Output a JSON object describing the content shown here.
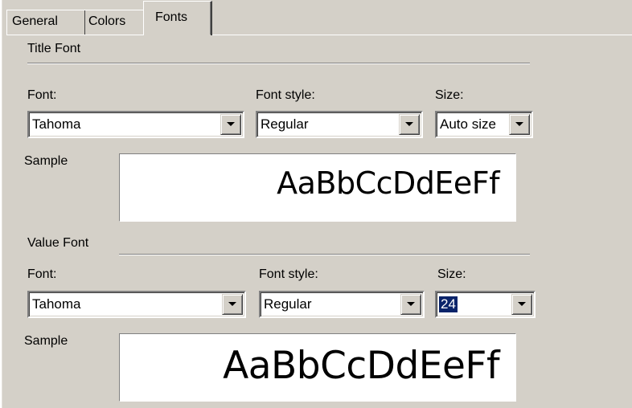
{
  "tabs": [
    {
      "label": "General",
      "active": false
    },
    {
      "label": "Colors",
      "active": false
    },
    {
      "label": "Fonts",
      "active": true
    }
  ],
  "title_font": {
    "heading": "Title Font",
    "font_label": "Font:",
    "font_value": "Tahoma",
    "style_label": "Font style:",
    "style_value": "Regular",
    "size_label": "Size:",
    "size_value": "Auto size",
    "sample_label": "Sample",
    "sample_text": "AaBbCcDdEeFf"
  },
  "value_font": {
    "heading": "Value Font",
    "font_label": "Font:",
    "font_value": "Tahoma",
    "style_label": "Font style:",
    "style_value": "Regular",
    "size_label": "Size:",
    "size_value": "24",
    "sample_label": "Sample",
    "sample_text": "AaBbCcDdEeFf"
  },
  "icons": {
    "dropdown": "chevron-down-icon"
  },
  "colors": {
    "dialog_background": "#d4d0c8",
    "selection_highlight": "#0a246a"
  }
}
